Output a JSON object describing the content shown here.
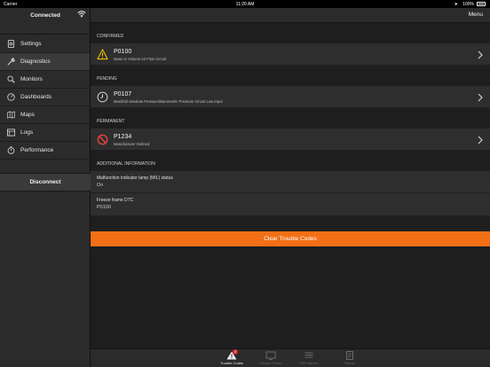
{
  "status_bar": {
    "carrier": "Carrier",
    "time": "11:20 AM",
    "battery": "100%"
  },
  "sidebar": {
    "title": "Connected",
    "items": [
      {
        "label": "Settings",
        "icon": "settings-icon"
      },
      {
        "label": "Diagnostics",
        "icon": "diagnostics-icon",
        "active": true
      },
      {
        "label": "Monitors",
        "icon": "monitors-icon"
      },
      {
        "label": "Dashboards",
        "icon": "dashboards-icon"
      },
      {
        "label": "Maps",
        "icon": "maps-icon"
      },
      {
        "label": "Logs",
        "icon": "logs-icon"
      },
      {
        "label": "Performance",
        "icon": "performance-icon"
      }
    ],
    "disconnect_label": "Disconnect"
  },
  "header": {
    "menu_label": "Menu"
  },
  "sections": {
    "confirmed": {
      "label": "CONFIRMED",
      "code": "P0100",
      "description": "Mass or Volume Air Flow Circuit",
      "icon": "warning-icon"
    },
    "pending": {
      "label": "PENDING",
      "code": "P0107",
      "description": "Manifold Absolute Pressure/Barometric Pressure Circuit Low Input",
      "icon": "clock-icon"
    },
    "permanent": {
      "label": "PERMANENT",
      "code": "P1234",
      "description": "Manufacturer Defined",
      "icon": "prohibited-icon"
    },
    "additional": {
      "label": "ADDITIONAL INFORMATION",
      "mil_label": "Malfunction indicator lamp (MIL) status",
      "mil_value": "On",
      "freeze_label": "Freeze frame DTC",
      "freeze_value": "P0100"
    }
  },
  "clear_button_label": "Clear Trouble Codes",
  "tabs": [
    {
      "label": "Trouble Codes",
      "active": true,
      "badge": "3"
    },
    {
      "label": "Freeze Frame"
    },
    {
      "label": "PID Values"
    },
    {
      "label": "Report"
    }
  ],
  "colors": {
    "accent": "#f26f16",
    "warning": "#e6c200",
    "error": "#e8443a",
    "badge": "#e02020"
  }
}
